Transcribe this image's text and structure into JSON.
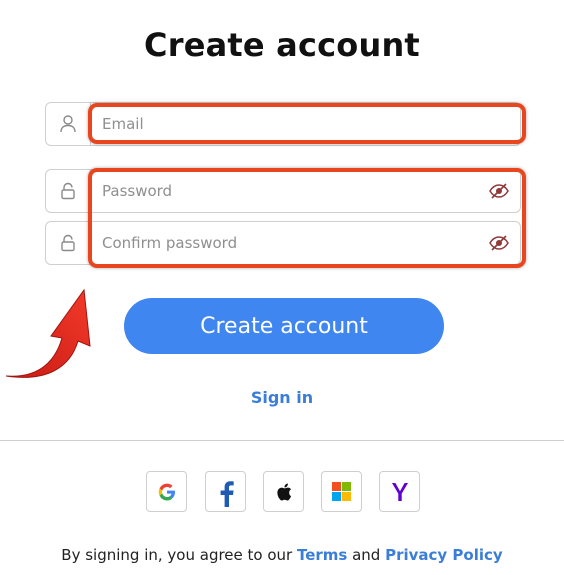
{
  "page": {
    "title": "Create account"
  },
  "form": {
    "email": {
      "placeholder": "Email",
      "value": ""
    },
    "password": {
      "placeholder": "Password",
      "value": ""
    },
    "confirm_password": {
      "placeholder": "Confirm password",
      "value": ""
    },
    "submit_label": "Create account"
  },
  "links": {
    "sign_in": "Sign in"
  },
  "social": [
    {
      "provider": "google",
      "icon": "google-icon",
      "glyph": "G"
    },
    {
      "provider": "facebook",
      "icon": "facebook-icon",
      "glyph": "f"
    },
    {
      "provider": "apple",
      "icon": "apple-icon",
      "glyph": ""
    },
    {
      "provider": "microsoft",
      "icon": "microsoft-icon",
      "glyph": ""
    },
    {
      "provider": "yahoo",
      "icon": "yahoo-icon",
      "glyph": "Y"
    }
  ],
  "legal": {
    "prefix": "By signing in, you agree to our ",
    "terms": "Terms",
    "conjunction": " and ",
    "privacy": "Privacy Policy"
  },
  "colors": {
    "primary": "#3f86f0",
    "link": "#3b7ed8",
    "annotation": "#e8461f",
    "border": "#cfcfcf"
  },
  "icons": {
    "email_field": "user-icon",
    "password_field": "lock-icon",
    "visibility": "eye-slash-icon",
    "annotation_arrow": "red-arrow-icon"
  }
}
